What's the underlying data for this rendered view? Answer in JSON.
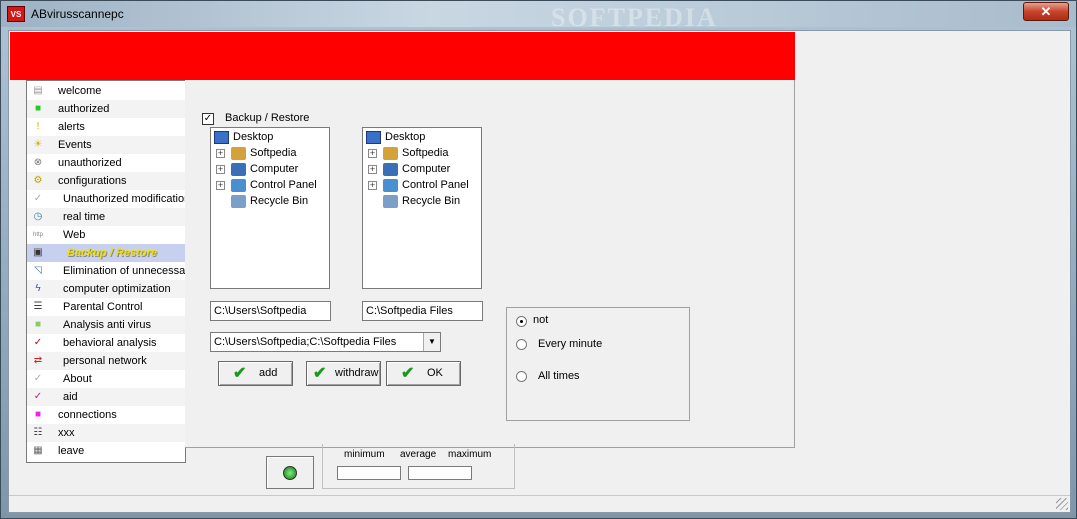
{
  "window": {
    "app_icon": "VS",
    "title": "ABvirusscannepc",
    "watermark": "SOFTPEDIA",
    "close_glyph": "✕"
  },
  "colors": {
    "banner": "#ff0000",
    "selected_item_bg": "#c8d0f0",
    "check_green": "#1a9a1a"
  },
  "menu": {
    "items": [
      {
        "label": "welcome",
        "icon": "document-icon",
        "glyph": "▤",
        "color": "#999"
      },
      {
        "label": "authorized",
        "icon": "green-square-icon",
        "glyph": "■",
        "color": "#22cc22"
      },
      {
        "label": "alerts",
        "icon": "alert-icon",
        "glyph": "!",
        "color": "#e0a000"
      },
      {
        "label": "Events",
        "icon": "lightbulb-icon",
        "glyph": "☀",
        "color": "#d8b000"
      },
      {
        "label": "unauthorized",
        "icon": "forbidden-icon",
        "glyph": "⊗",
        "color": "#777"
      },
      {
        "label": "configurations",
        "icon": "settings-icon",
        "glyph": "⚙",
        "color": "#c0a000"
      },
      {
        "label": "Unauthorized modifications",
        "icon": "checkmark-icon",
        "glyph": "✓",
        "color": "#aaa"
      },
      {
        "label": "real time",
        "icon": "clock-icon",
        "glyph": "◷",
        "color": "#4477aa"
      },
      {
        "label": "Web",
        "icon": "http-icon",
        "glyph": "http",
        "color": "#888"
      },
      {
        "label": "Backup / Restore",
        "icon": "backup-icon",
        "glyph": "▣",
        "color": "#333"
      },
      {
        "label": "Elimination of unnecessary files",
        "icon": "cleanup-icon",
        "glyph": "◹",
        "color": "#4477aa"
      },
      {
        "label": "computer optimization",
        "icon": "lightning-icon",
        "glyph": "ϟ",
        "color": "#3355aa"
      },
      {
        "label": "Parental Control",
        "icon": "list-icon",
        "glyph": "☰",
        "color": "#444"
      },
      {
        "label": "Analysis anti virus",
        "icon": "scan-icon",
        "glyph": "■",
        "color": "#88cc66"
      },
      {
        "label": "behavioral analysis",
        "icon": "red-check-icon",
        "glyph": "✓",
        "color": "#cc0000"
      },
      {
        "label": "personal network",
        "icon": "network-icon",
        "glyph": "⇄",
        "color": "#cc2222"
      },
      {
        "label": "About",
        "icon": "about-icon",
        "glyph": "✓",
        "color": "#aaa"
      },
      {
        "label": "aid",
        "icon": "help-check-icon",
        "glyph": "✓",
        "color": "#aa2288"
      },
      {
        "label": "connections",
        "icon": "magenta-square-icon",
        "glyph": "■",
        "color": "#ee22ee"
      },
      {
        "label": "xxx",
        "icon": "grid-icon",
        "glyph": "☷",
        "color": "#444"
      },
      {
        "label": "leave",
        "icon": "exit-icon",
        "glyph": "▦",
        "color": "#666"
      }
    ]
  },
  "backup": {
    "checkbox_label": "Backup / Restore",
    "checkbox_checked": "✓",
    "left_tree": {
      "root": "Desktop",
      "children": [
        "Softpedia",
        "Computer",
        "Control Panel",
        "Recycle Bin"
      ]
    },
    "right_tree": {
      "root": "Desktop",
      "children": [
        "Softpedia",
        "Computer",
        "Control Panel",
        "Recycle Bin"
      ]
    },
    "left_path": "C:\\Users\\Softpedia",
    "right_path": "C:\\Softpedia Files",
    "combo_value": "C:\\Users\\Softpedia;C:\\Softpedia Files",
    "buttons": {
      "add": "add",
      "withdraw": "withdraw",
      "ok": "OK"
    },
    "schedule": {
      "options": [
        "not",
        "Every minute",
        "All times"
      ],
      "selected": "not"
    }
  },
  "stats": {
    "minimum": "minimum",
    "average": "average",
    "maximum": "maximum"
  }
}
